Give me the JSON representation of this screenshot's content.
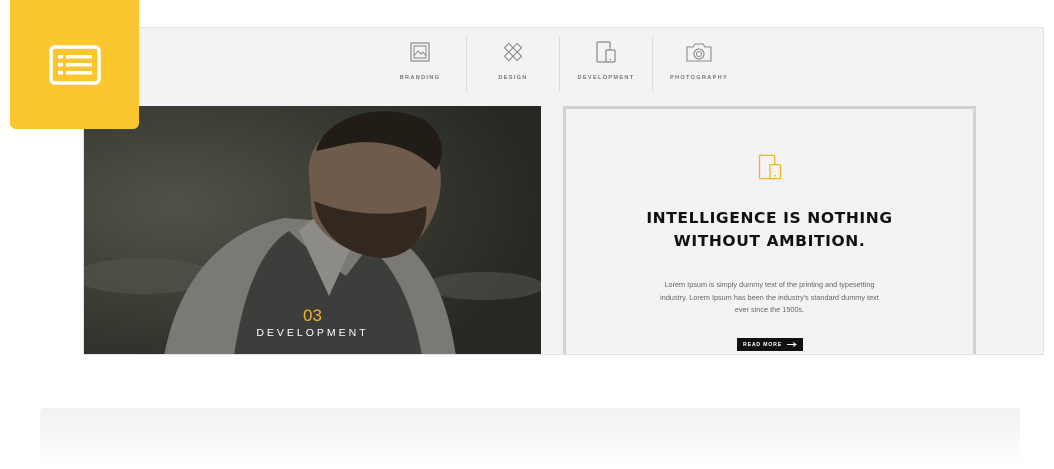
{
  "tabs": [
    {
      "label": "BRANDING",
      "icon": "image-frame-icon"
    },
    {
      "label": "DESIGN",
      "icon": "pencil-ruler-icon"
    },
    {
      "label": "DEVELOPMENT",
      "icon": "devices-icon"
    },
    {
      "label": "PHOTOGRAPHY",
      "icon": "camera-icon"
    }
  ],
  "slide": {
    "number": "03",
    "label": "DEVELOPMENT"
  },
  "card": {
    "title_line1": "INTELLIGENCE IS NOTHING",
    "title_line2": "WITHOUT AMBITION.",
    "body": "Lorem Ipsum is simply dummy text of the printing and typesetting industry. Lorem Ipsum has been the industry's standard dummy text ever since the 1500s.",
    "button_label": "READ MORE"
  },
  "colors": {
    "accent": "#fcc72e",
    "number": "#f0b429",
    "button": "#111111"
  }
}
